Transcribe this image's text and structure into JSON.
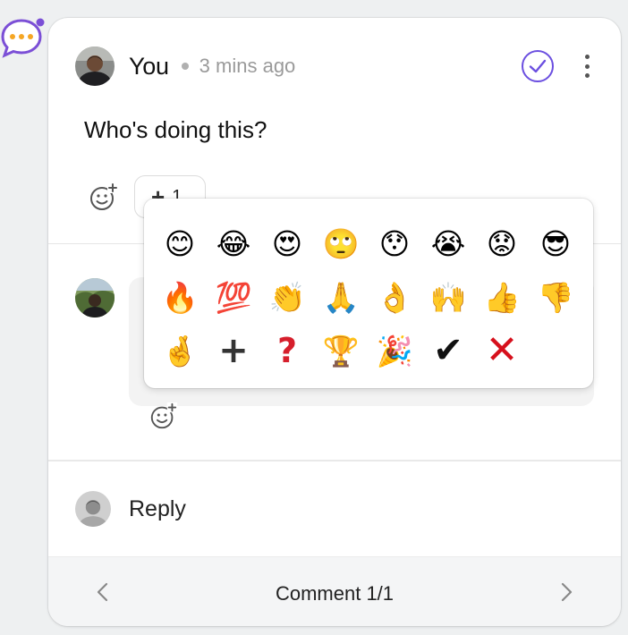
{
  "comment": {
    "author": "You",
    "time": "3 mins ago",
    "body": "Who's doing this?",
    "reaction_chip": {
      "emoji": "+",
      "count": "1"
    }
  },
  "emoji_picker": {
    "emojis": [
      "😊",
      "😂",
      "😍",
      "🙄",
      "😯",
      "😭",
      "😟",
      "😎",
      "🔥",
      "💯",
      "👏",
      "🙏",
      "👌",
      "🙌",
      "👍",
      "👎",
      "🤞",
      "+",
      "?",
      "🏆",
      "🎉",
      "✔",
      "✕"
    ]
  },
  "reply": {
    "label": "Reply"
  },
  "footer": {
    "label": "Comment 1/1"
  },
  "colors": {
    "accent": "#6b4fe0",
    "marker": "#7b4fd6",
    "marker_dots": "#f5a623"
  },
  "icons": {
    "thread_marker": "chat-bubble-icon",
    "resolve": "check-circle-icon",
    "more": "more-vertical-icon",
    "add_reaction": "add-reaction-icon",
    "prev": "chevron-left-icon",
    "next": "chevron-right-icon"
  }
}
